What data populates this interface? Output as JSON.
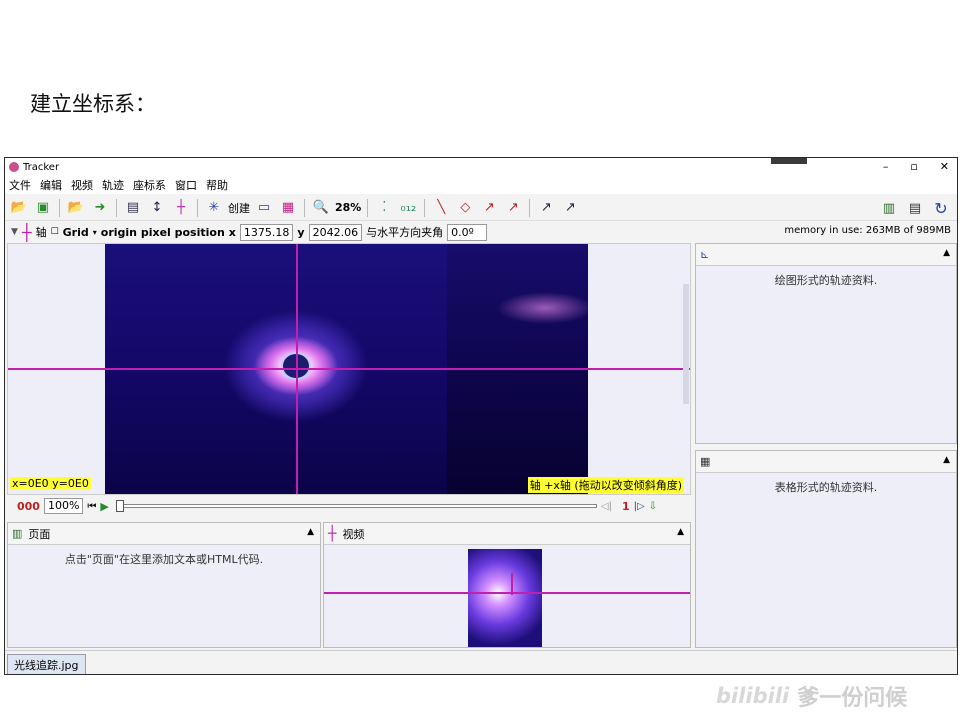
{
  "slide": {
    "heading": "建立坐标系："
  },
  "window": {
    "title": "Tracker",
    "controls": [
      "–",
      "▫",
      "✕"
    ]
  },
  "menu": [
    "文件",
    "编辑",
    "视频",
    "轨迹",
    "座标系",
    "窗口",
    "帮助"
  ],
  "toolbar": {
    "create_label": "创建",
    "zoom": "28%"
  },
  "coord_bar": {
    "axis_label": "轴",
    "grid_label": "Grid",
    "origin_label": "origin pixel position",
    "x_label": "x",
    "x_value": "1375.18",
    "y_label": "y",
    "y_value": "2042.06",
    "angle_label": "与水平方向夹角",
    "angle_value": "0.0º",
    "memory": "memory in use: 263MB of 989MB"
  },
  "video": {
    "coord_readout": "x=0E0  y=0E0",
    "axis_hint": "轴 +x轴 (拖动以改变倾斜角度)"
  },
  "player": {
    "frame": "000",
    "zoom": "100%",
    "step": "1"
  },
  "panels": {
    "page": {
      "title": "页面",
      "body": "点击\"页面\"在这里添加文本或HTML代码."
    },
    "video": {
      "title": "视频"
    },
    "plot": {
      "body": "绘图形式的轨迹资料."
    },
    "table": {
      "body": "表格形式的轨迹资料."
    }
  },
  "file_tab": "光线追踪.jpg",
  "watermark": {
    "logo": "bilibili",
    "text": "爹一份问候"
  },
  "colors": {
    "axis": "#c020b0",
    "highlight": "#ffff33",
    "frame_red": "#c02020"
  }
}
